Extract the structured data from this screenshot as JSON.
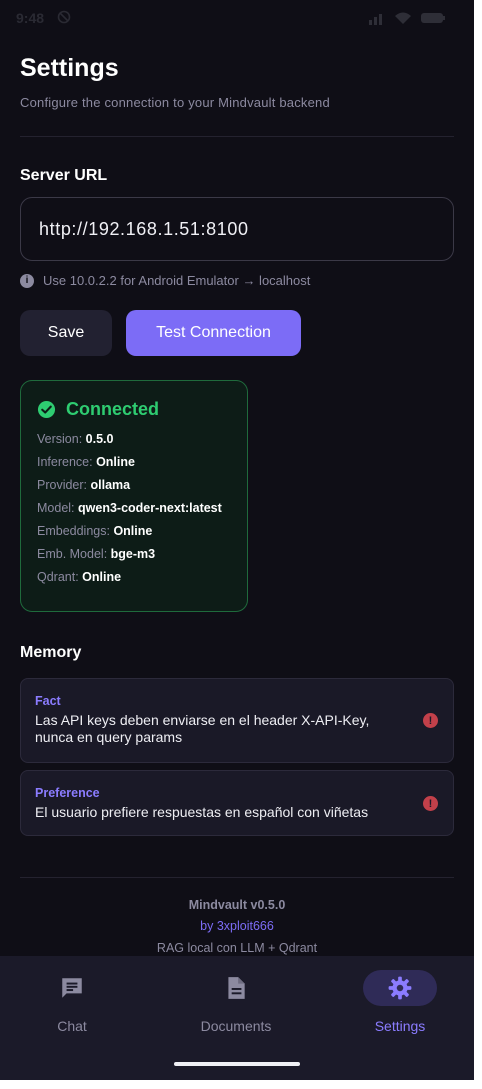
{
  "status_bar": {
    "time": "9:48"
  },
  "header": {
    "title": "Settings",
    "subtitle": "Configure the connection to your Mindvault backend"
  },
  "server": {
    "label": "Server URL",
    "value": "http://192.168.1.51:8100",
    "hint": "Use 10.0.2.2 for Android Emulator → localhost"
  },
  "buttons": {
    "save": "Save",
    "test": "Test Connection"
  },
  "connection": {
    "title": "Connected",
    "status_color": "#2ecc71",
    "fields": [
      {
        "label": "Version:",
        "value": "0.5.0"
      },
      {
        "label": "Inference:",
        "value": "Online"
      },
      {
        "label": "Provider:",
        "value": "ollama"
      },
      {
        "label": "Model:",
        "value": "qwen3-coder-next:latest"
      },
      {
        "label": "Embeddings:",
        "value": "Online"
      },
      {
        "label": "Emb. Model:",
        "value": "bge-m3"
      },
      {
        "label": "Qdrant:",
        "value": "Online"
      }
    ]
  },
  "memory": {
    "label": "Memory",
    "items": [
      {
        "type": "Fact",
        "text": "Las API keys deben enviarse en el header X-API-Key, nunca en query params"
      },
      {
        "type": "Preference",
        "text": "El usuario prefiere respuestas en español con viñetas"
      }
    ]
  },
  "footer": {
    "name": "Mindvault v0.5.0",
    "by": "by 3xploit666",
    "desc": "RAG local con LLM + Qdrant"
  },
  "nav": {
    "items": [
      {
        "label": "Chat",
        "icon": "chat-icon"
      },
      {
        "label": "Documents",
        "icon": "document-icon"
      },
      {
        "label": "Settings",
        "icon": "gear-icon",
        "active": true
      }
    ]
  },
  "colors": {
    "accent": "#7c6cf6",
    "background": "#0f0e16",
    "danger": "#c2404a"
  }
}
